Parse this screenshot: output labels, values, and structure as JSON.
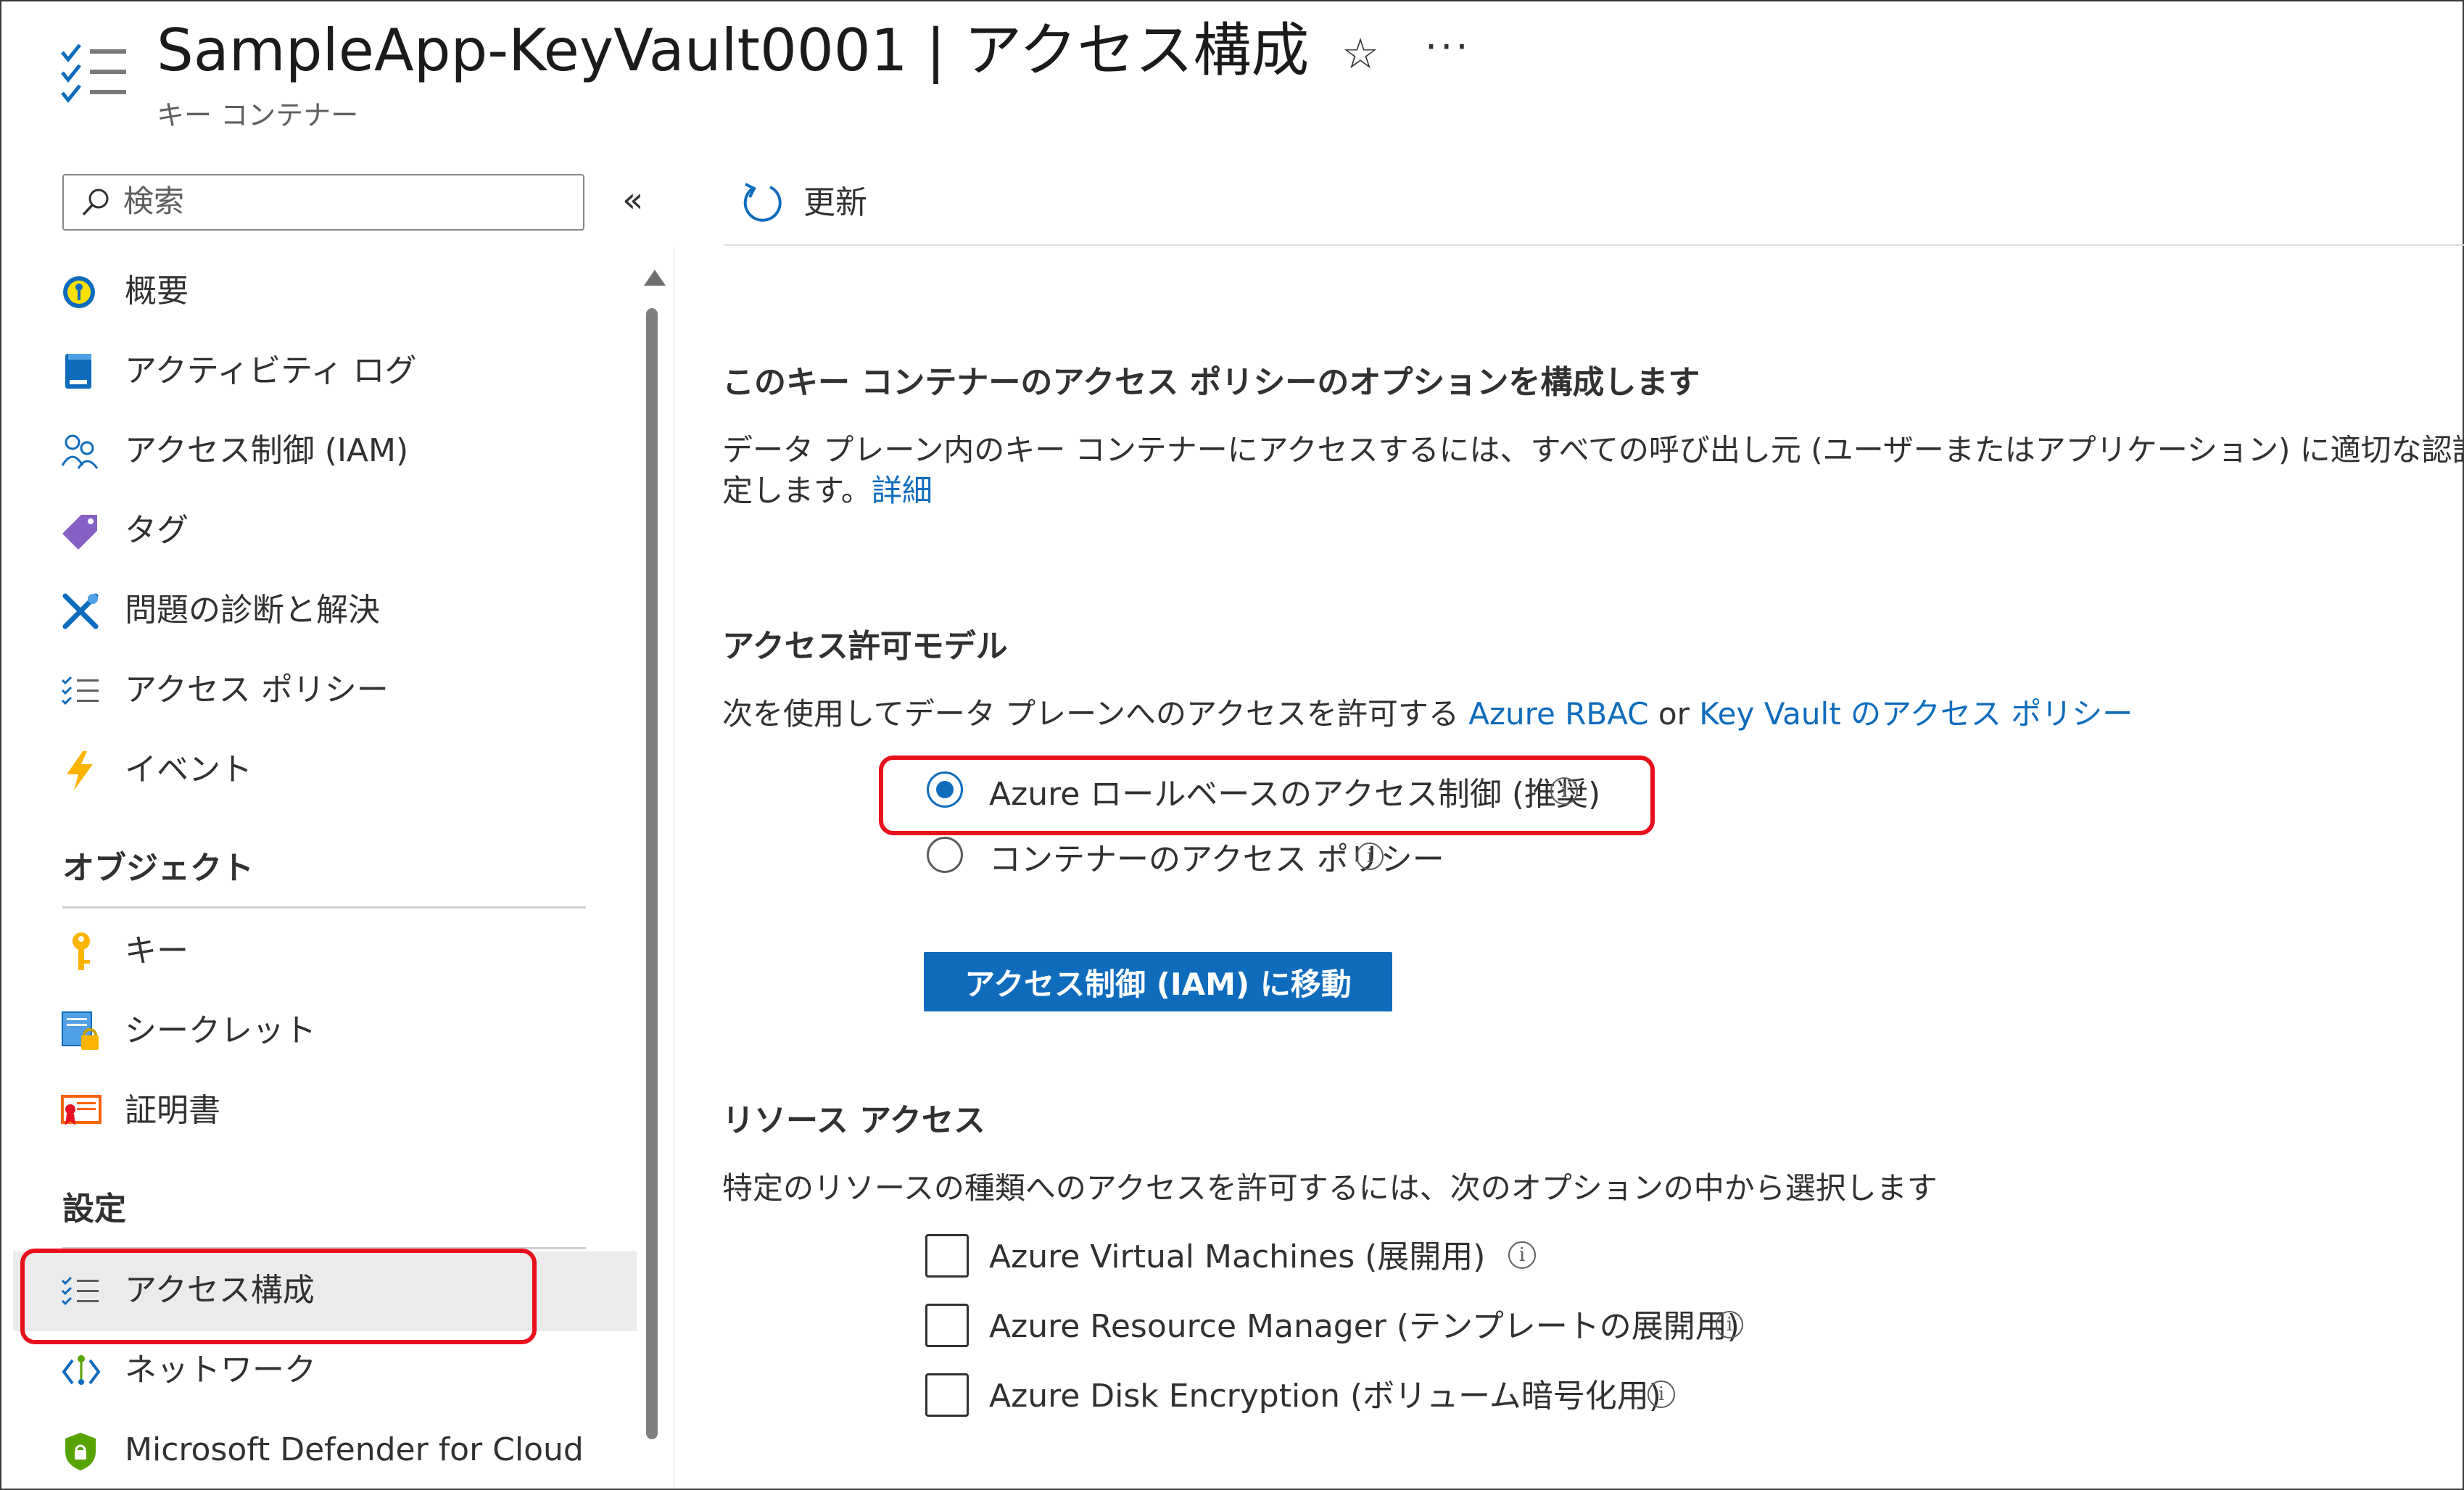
{
  "header": {
    "title": "SampleApp-KeyVault0001 | アクセス構成",
    "subtitle": "キー コンテナー",
    "favorite_icon": "☆",
    "more_icon": "···"
  },
  "sidebar": {
    "search_placeholder": "検索",
    "collapse_glyph": "«",
    "items_top": [
      {
        "label": "概要",
        "icon": "overview-key-icon"
      },
      {
        "label": "アクティビティ ログ",
        "icon": "activity-log-icon"
      },
      {
        "label": "アクセス制御 (IAM)",
        "icon": "people-icon"
      },
      {
        "label": "タグ",
        "icon": "tag-icon"
      },
      {
        "label": "問題の診断と解決",
        "icon": "wrench-icon"
      },
      {
        "label": "アクセス ポリシー",
        "icon": "checklist-icon"
      },
      {
        "label": "イベント",
        "icon": "bolt-icon"
      }
    ],
    "section_objects": "オブジェクト",
    "items_objects": [
      {
        "label": "キー",
        "icon": "key-icon"
      },
      {
        "label": "シークレット",
        "icon": "secret-icon"
      },
      {
        "label": "証明書",
        "icon": "certificate-icon"
      }
    ],
    "section_settings": "設定",
    "items_settings": [
      {
        "label": "アクセス構成",
        "icon": "checklist-icon",
        "selected": true
      },
      {
        "label": "ネットワーク",
        "icon": "network-icon"
      },
      {
        "label": "Microsoft Defender for Cloud",
        "icon": "defender-shield-icon"
      }
    ]
  },
  "toolbar": {
    "refresh_label": "更新"
  },
  "main": {
    "intro_heading": "このキー コンテナーのアクセス ポリシーのオプションを構成します",
    "intro_text_line1": "データ プレーン内のキー コンテナーにアクセスするには、すべての呼び出し元 (ユーザーまたはアプリケーション) に適切な認証と認可が必要です",
    "intro_text_line2": "定します。",
    "intro_link": "詳細",
    "permission_heading": "アクセス許可モデル",
    "permission_text": "次を使用してデータ プレーンへのアクセスを許可する",
    "permission_link1": "Azure RBAC",
    "permission_or": "or",
    "permission_link2": "Key Vault のアクセス ポリシー",
    "radio_options": [
      {
        "label": "Azure ロールベースのアクセス制御 (推奨)",
        "selected": true
      },
      {
        "label": "コンテナーのアクセス ポリシー",
        "selected": false
      }
    ],
    "goto_iam_button": "アクセス制御 (IAM) に移動",
    "resource_heading": "リソース アクセス",
    "resource_text": "特定のリソースの種類へのアクセスを許可するには、次のオプションの中から選択します",
    "checkboxes": [
      {
        "label": "Azure Virtual Machines (展開用)",
        "checked": false
      },
      {
        "label": "Azure Resource Manager (テンプレートの展開用)",
        "checked": false
      },
      {
        "label": "Azure Disk Encryption (ボリューム暗号化用)",
        "checked": false
      }
    ],
    "info_glyph": "i"
  },
  "colors": {
    "accent": "#0f6cbd",
    "highlight_red": "#e8101d",
    "selected_bg": "#ebebeb"
  }
}
